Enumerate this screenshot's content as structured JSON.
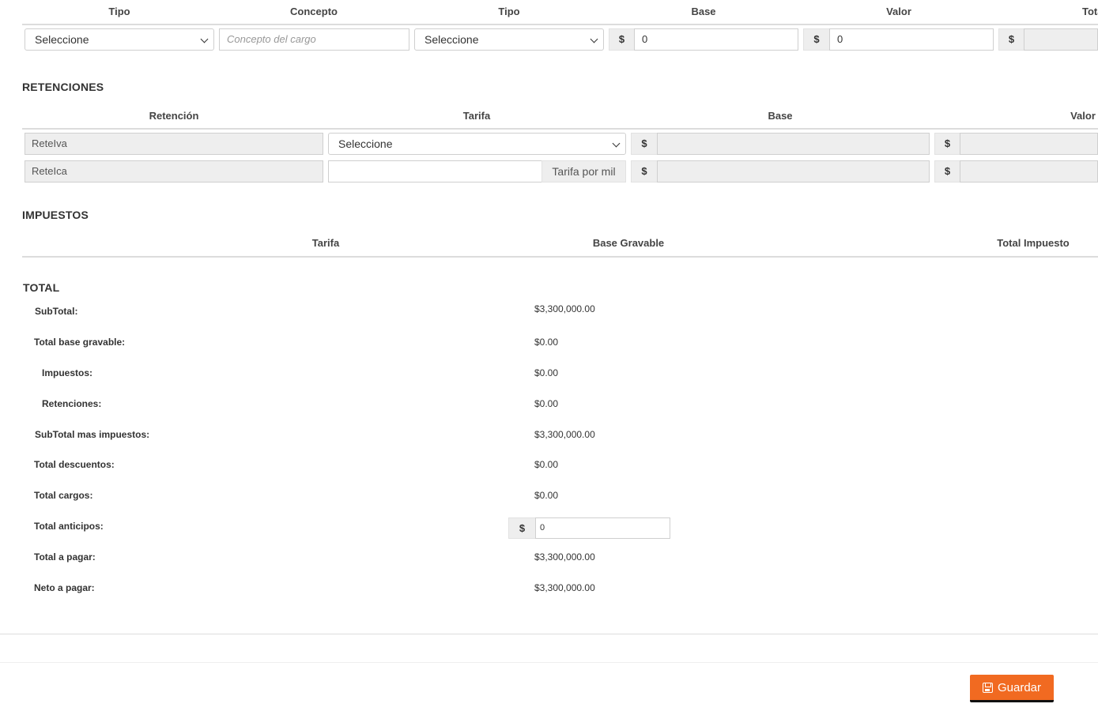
{
  "cargos": {
    "headers": [
      "Tipo",
      "Concepto",
      "Tipo",
      "Base",
      "Valor",
      "Total"
    ],
    "row": {
      "tipo_select": "Seleccione",
      "concepto_placeholder": "Concepto del cargo",
      "tipo2_select": "Seleccione",
      "currency": "$",
      "base_value": "0",
      "valor_value": "0"
    }
  },
  "retenciones": {
    "title": "RETENCIONES",
    "headers": [
      "Retención",
      "Tarifa",
      "Base",
      "Valor"
    ],
    "rows": [
      {
        "label": "ReteIva",
        "tarifa_select": "Seleccione",
        "currency": "$"
      },
      {
        "label": "ReteIca",
        "tarifa_suffix": "Tarifa por mil",
        "currency": "$"
      }
    ]
  },
  "impuestos": {
    "title": "IMPUESTOS",
    "headers": [
      "Tarifa",
      "Base Gravable",
      "Total Impuesto"
    ]
  },
  "total": {
    "title": "TOTAL",
    "rows": [
      {
        "label": "SubTotal:",
        "value": "$3,300,000.00"
      },
      {
        "label": "Total base gravable:",
        "value": "$0.00"
      },
      {
        "label": "Impuestos:",
        "value": "$0.00"
      },
      {
        "label": "Retenciones:",
        "value": "$0.00"
      },
      {
        "label": "SubTotal mas impuestos:",
        "value": "$3,300,000.00"
      },
      {
        "label": "Total descuentos:",
        "value": "$0.00"
      },
      {
        "label": "Total cargos:",
        "value": "$0.00"
      },
      {
        "label": "Total anticipos:",
        "currency": "$",
        "input_value": "0"
      },
      {
        "label": "Total a pagar:",
        "value": "$3,300,000.00"
      },
      {
        "label": "Neto a pagar:",
        "value": "$3,300,000.00"
      }
    ]
  },
  "footer": {
    "save_label": "Guardar",
    "save_icon": "floppy-disk-icon",
    "accent_color": "#f16a21"
  }
}
